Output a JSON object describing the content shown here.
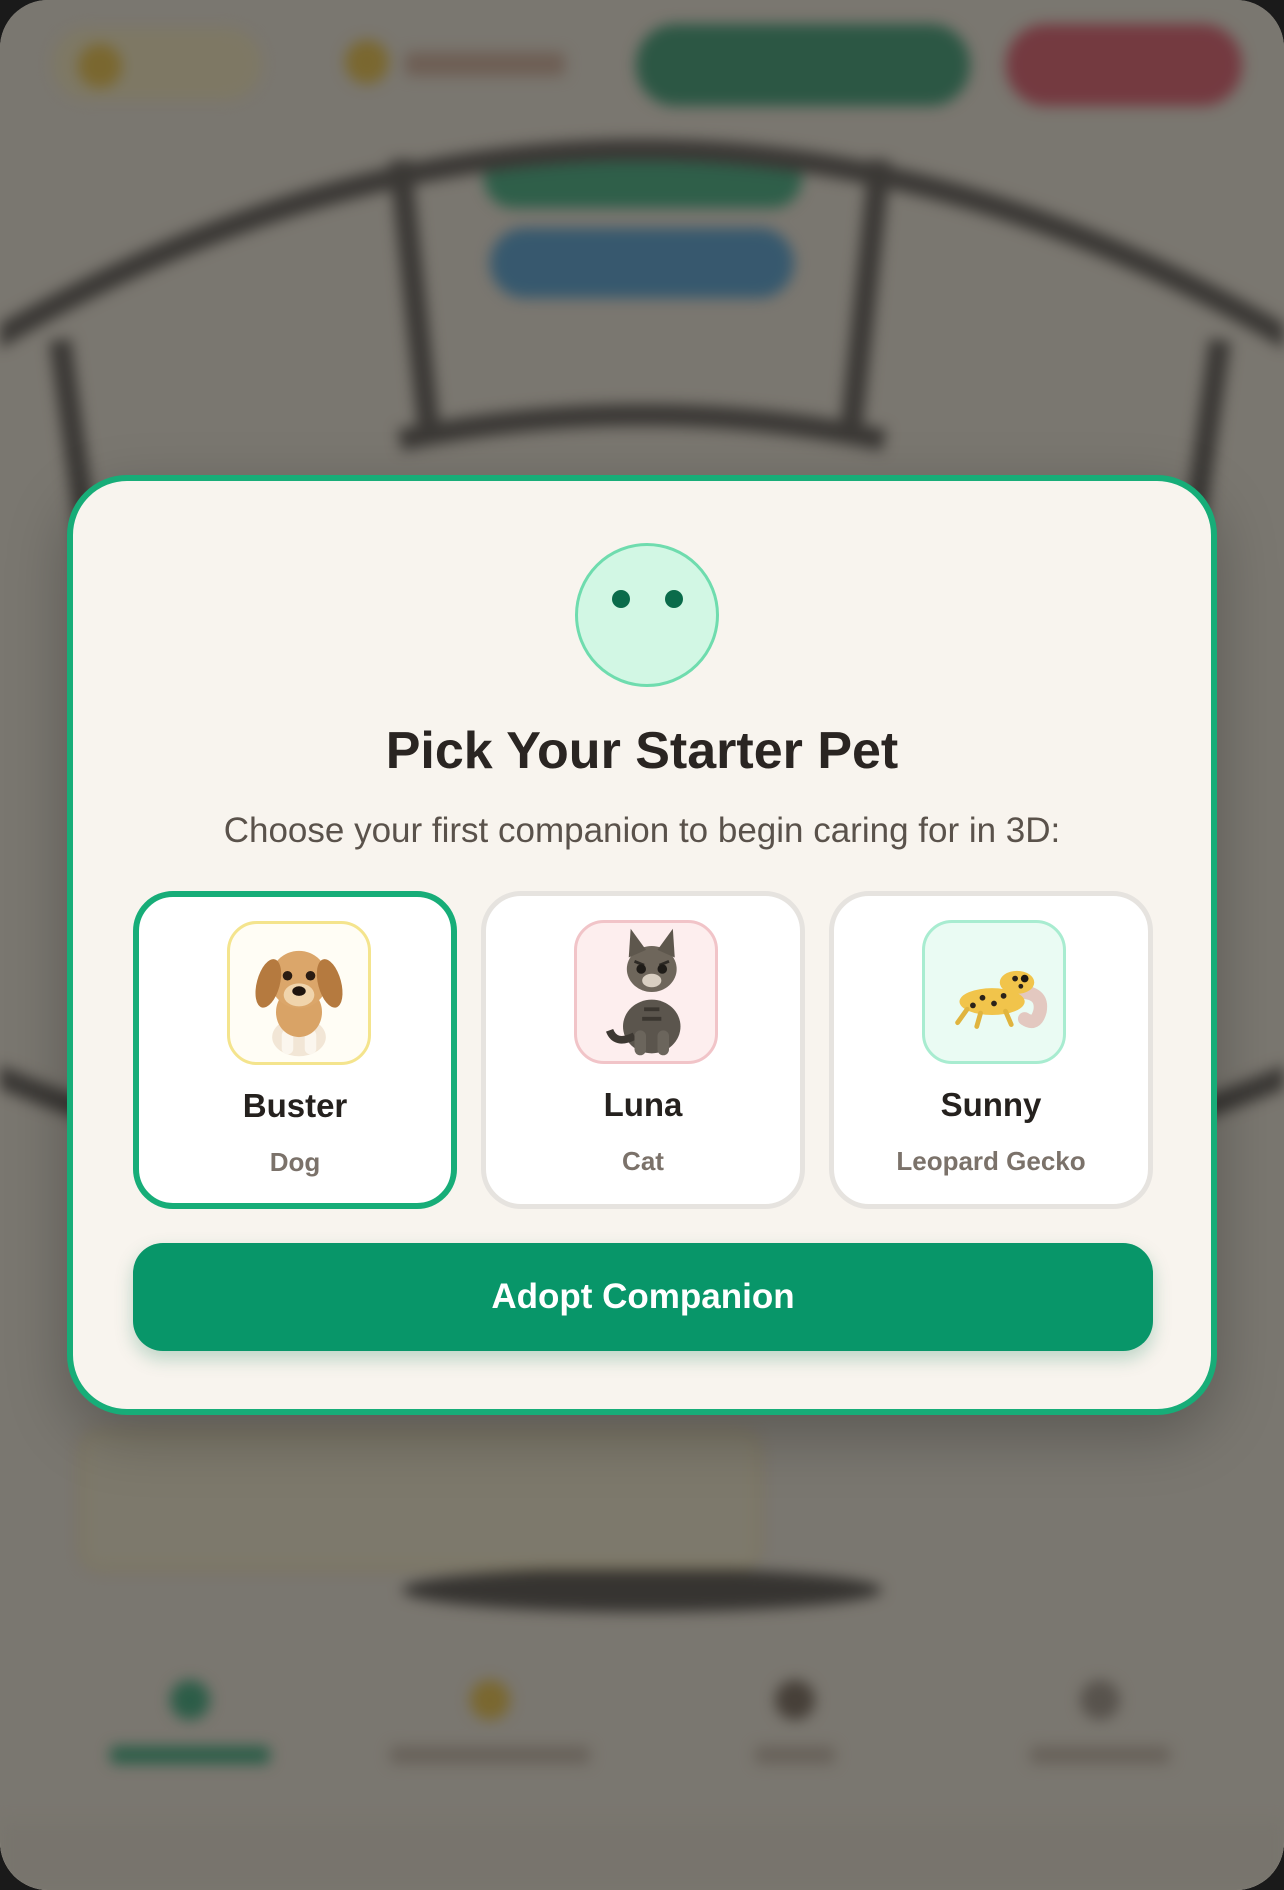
{
  "modal": {
    "title": "Pick Your Starter Pet",
    "subtitle": "Choose your first companion to begin caring for in 3D:",
    "avatar_icon": "smiley-face-icon",
    "selected_pet": "Buster",
    "pets": [
      {
        "name": "Buster",
        "type": "Dog",
        "icon": "dog-photo",
        "accent": "#f4e48d"
      },
      {
        "name": "Luna",
        "type": "Cat",
        "icon": "cat-photo",
        "accent": "#f1c4c8"
      },
      {
        "name": "Sunny",
        "type": "Leopard Gecko",
        "icon": "gecko-photo",
        "accent": "#a8ecd0"
      }
    ],
    "adopt_label": "Adopt Companion"
  },
  "colors": {
    "accent_green": "#17ad78",
    "button_green": "#089669",
    "modal_bg": "#f8f4ee",
    "overlay": "rgba(60,58,54,0.64)"
  }
}
